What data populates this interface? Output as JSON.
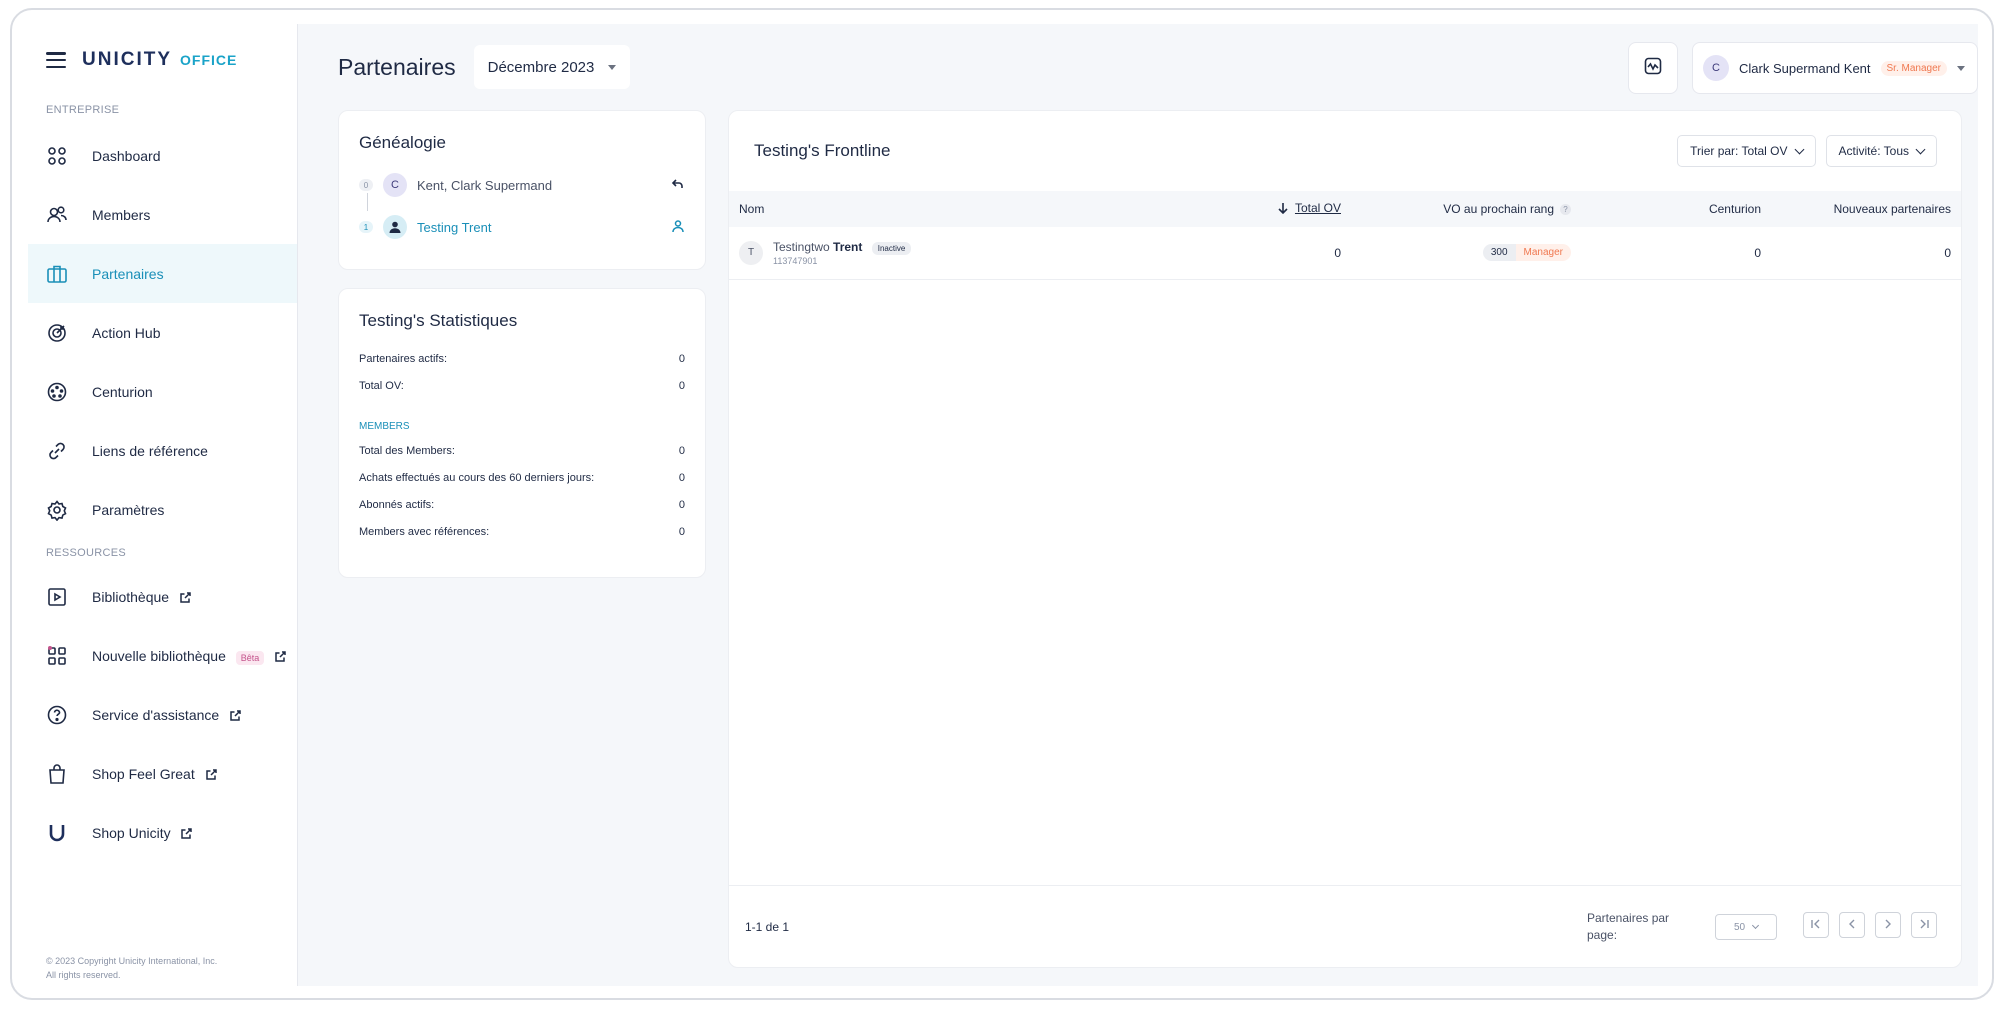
{
  "brand": {
    "main": "UNICITY",
    "sub": "OFFICE"
  },
  "sidebar": {
    "section_enterprise": "ENTREPRISE",
    "section_resources": "RESSOURCES",
    "items": [
      {
        "label": "Dashboard",
        "icon": "dashboard-icon"
      },
      {
        "label": "Members",
        "icon": "members-icon"
      },
      {
        "label": "Partenaires",
        "icon": "briefcase-icon"
      },
      {
        "label": "Action Hub",
        "icon": "target-icon"
      },
      {
        "label": "Centurion",
        "icon": "centurion-icon"
      },
      {
        "label": "Liens de référence",
        "icon": "link-icon"
      },
      {
        "label": "Paramètres",
        "icon": "gear-icon"
      }
    ],
    "resources": [
      {
        "label": "Bibliothèque",
        "icon": "library-icon"
      },
      {
        "label": "Nouvelle bibliothèque",
        "icon": "apps-icon",
        "badge": "Bêta"
      },
      {
        "label": "Service d'assistance",
        "icon": "help-icon"
      },
      {
        "label": "Shop Feel Great",
        "icon": "bag-icon"
      },
      {
        "label": "Shop Unicity",
        "icon": "unicity-icon"
      }
    ],
    "copyright_1": "© 2023 Copyright Unicity International, Inc.",
    "copyright_2": "All rights reserved."
  },
  "topbar": {
    "title": "Partenaires",
    "month": "Décembre 2023",
    "user_initial": "C",
    "user_name": "Clark Supermand Kent",
    "user_rank": "Sr. Manager"
  },
  "genealogy": {
    "title": "Généalogie",
    "rows": [
      {
        "level": "0",
        "initial": "C",
        "name": "Kent, Clark Supermand"
      },
      {
        "level": "1",
        "name": "Testing Trent"
      }
    ]
  },
  "stats": {
    "title": "Testing's Statistiques",
    "rows": [
      {
        "label": "Partenaires actifs:",
        "value": "0"
      },
      {
        "label": "Total OV:",
        "value": "0"
      }
    ],
    "members_section": "MEMBERS",
    "member_rows": [
      {
        "label": "Total des Members:",
        "value": "0"
      },
      {
        "label": "Achats effectués au cours des 60 derniers jours:",
        "value": "0"
      },
      {
        "label": "Abonnés actifs:",
        "value": "0"
      },
      {
        "label": "Members avec références:",
        "value": "0"
      }
    ]
  },
  "frontline": {
    "title": "Testing's Frontline",
    "sort_label": "Trier par: Total OV",
    "activity_label": "Activité: Tous",
    "columns": {
      "name": "Nom",
      "total_ov": "Total OV",
      "vo_next": "VO au prochain rang",
      "centurion": "Centurion",
      "new_partners": "Nouveaux partenaires"
    },
    "rows": [
      {
        "initial": "T",
        "first": "Testingtwo",
        "last": "Trent",
        "status": "Inactive",
        "id": "113747901",
        "total_ov": "0",
        "vo_value": "300",
        "vo_rank": "Manager",
        "centurion": "0",
        "new_partners": "0"
      }
    ],
    "range": "1-1 de 1",
    "per_page_label": "Partenaires par page:",
    "per_page_value": "50"
  }
}
